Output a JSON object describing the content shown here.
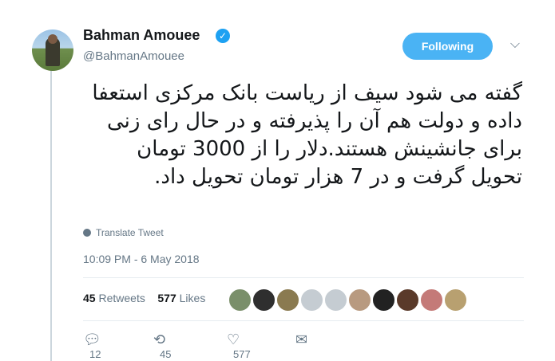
{
  "author": {
    "name": "Bahman Amouee",
    "handle": "@BahmanAmouee",
    "verified": true,
    "accent_color": "#1da1f2"
  },
  "follow_button": {
    "label": "Following",
    "color": "#4ab3f4"
  },
  "tweet": {
    "text": "گفته می شود سیف از ریاست بانک مرکزی استعفا داده و دولت هم آن را پذیرفته و در حال رای زنی برای جانشینش هستند.دلار را از 3000 تومان تحویل گرفت و در 7 هزار تومان تحویل داد.",
    "translate_label": "Translate Tweet",
    "timestamp": "10:09 PM - 6 May 2018"
  },
  "stats": {
    "retweets_count": "45",
    "retweets_label": "Retweets",
    "likes_count": "577",
    "likes_label": "Likes"
  },
  "liker_avatar_colors": [
    "#7a8f6a",
    "#2f2f2f",
    "#8a7a50",
    "#c5ccd2",
    "#c5ccd2",
    "#b89a80",
    "#222222",
    "#5a3a2a",
    "#c47a78",
    "#b8a070"
  ],
  "actions": {
    "reply_icon": "reply-icon",
    "reply_count": "12",
    "retweet_icon": "retweet-icon",
    "retweet_count": "45",
    "like_icon": "heart-icon",
    "like_count": "577",
    "message_icon": "envelope-icon"
  }
}
